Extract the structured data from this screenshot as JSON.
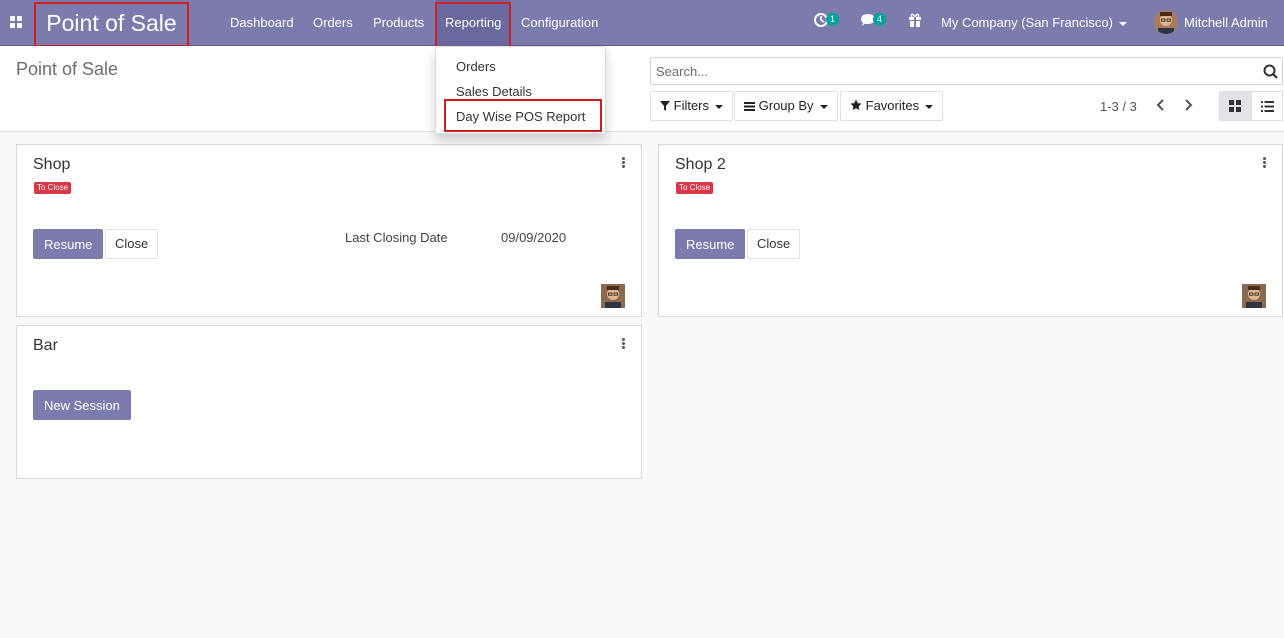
{
  "app_title": "Point of Sale",
  "nav": {
    "menus": [
      "Dashboard",
      "Orders",
      "Products",
      "Reporting",
      "Configuration"
    ],
    "active_menu": "Reporting",
    "activity_count": "1",
    "message_count": "4",
    "company": "My Company (San Francisco)",
    "user": "Mitchell Admin"
  },
  "reporting_menu": {
    "items": [
      "Orders",
      "Sales Details",
      "Day Wise POS Report"
    ],
    "highlighted": "Day Wise POS Report"
  },
  "control_panel": {
    "page_title": "Point of Sale",
    "search_placeholder": "Search...",
    "filters_label": "Filters",
    "groupby_label": "Group By",
    "favorites_label": "Favorites",
    "pager": "1-3 / 3",
    "view_mode": "kanban"
  },
  "cards": [
    {
      "name": "Shop",
      "tag": "To Close",
      "primary_button": "Resume",
      "secondary_button": "Close",
      "last_closing_label": "Last Closing Date",
      "last_closing_date": "09/09/2020"
    },
    {
      "name": "Shop 2",
      "tag": "To Close",
      "primary_button": "Resume",
      "secondary_button": "Close"
    },
    {
      "name": "Bar",
      "primary_button": "New Session"
    }
  ],
  "colors": {
    "brand": "#7c7bad",
    "highlight_border": "#d01f23",
    "tag_red": "#dc3545",
    "badge_teal": "#00a09d"
  }
}
